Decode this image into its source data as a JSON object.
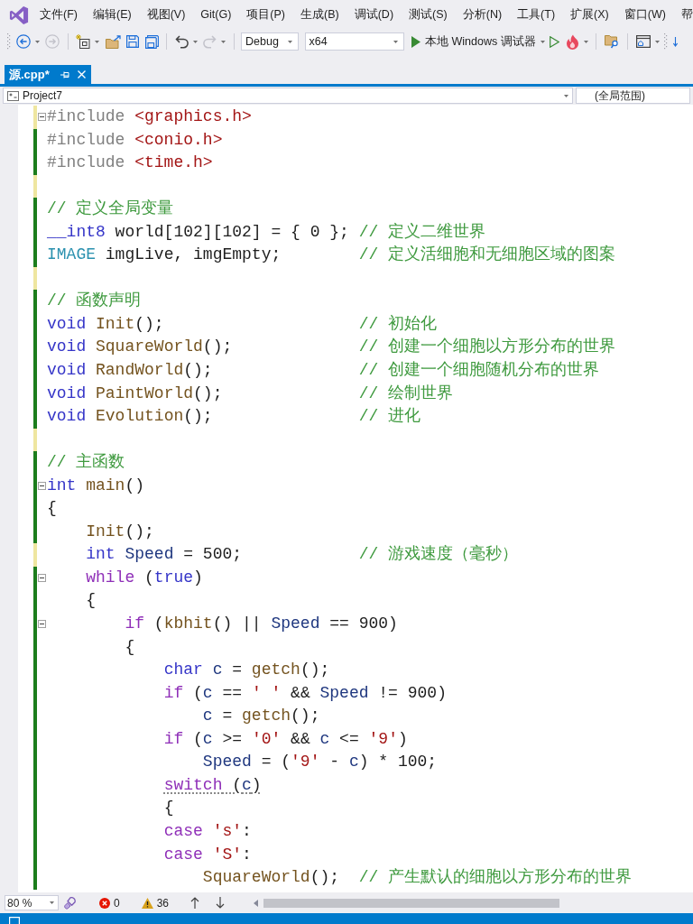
{
  "menu": {
    "items": [
      "文件(F)",
      "编辑(E)",
      "视图(V)",
      "Git(G)",
      "项目(P)",
      "生成(B)",
      "调试(D)",
      "测试(S)",
      "分析(N)",
      "工具(T)",
      "扩展(X)",
      "窗口(W)",
      "帮"
    ]
  },
  "toolbar": {
    "items": [
      {
        "kind": "grip"
      },
      {
        "kind": "back",
        "disabled": false,
        "dropdown": true
      },
      {
        "kind": "forward",
        "disabled": true,
        "dropdown": false
      },
      {
        "kind": "separator"
      },
      {
        "kind": "new_item",
        "disabled": false,
        "dropdown": true
      },
      {
        "kind": "open",
        "disabled": false,
        "dropdown": false
      },
      {
        "kind": "save",
        "disabled": false,
        "dropdown": false
      },
      {
        "kind": "save_all",
        "disabled": false,
        "dropdown": false
      },
      {
        "kind": "separator"
      },
      {
        "kind": "undo",
        "disabled": false,
        "dropdown": true
      },
      {
        "kind": "redo",
        "disabled": true,
        "dropdown": true
      },
      {
        "kind": "separator"
      },
      {
        "kind": "configuration_combo",
        "value": "Debug"
      },
      {
        "kind": "platform_combo",
        "value": "x64"
      },
      {
        "kind": "run",
        "label": "本地 Windows 调试器",
        "dropdown": true
      },
      {
        "kind": "run_no_debug",
        "disabled": false,
        "dropdown": false
      },
      {
        "kind": "hot_reload",
        "disabled": false,
        "dropdown": true
      },
      {
        "kind": "separator"
      },
      {
        "kind": "find_folder",
        "disabled": false,
        "dropdown": false
      },
      {
        "kind": "separator"
      },
      {
        "kind": "window",
        "disabled": false,
        "dropdown": true
      },
      {
        "kind": "grip"
      },
      {
        "kind": "step",
        "disabled": false,
        "dropdown": false
      }
    ]
  },
  "tabs": [
    {
      "label": "源.cpp*",
      "selected": true
    }
  ],
  "navigation": {
    "project": "Project7",
    "scope": "(全局范围)"
  },
  "code": {
    "lines": [
      {
        "segments": [
          {
            "text": "#include ",
            "kind": "preprocessor"
          },
          {
            "text": "<graphics.h>",
            "kind": "string"
          }
        ],
        "unsaved": true,
        "fold": true,
        "squiggle": false
      },
      {
        "segments": [
          {
            "text": "#include ",
            "kind": "preprocessor"
          },
          {
            "text": "<conio.h>",
            "kind": "string"
          }
        ],
        "unsaved": false,
        "fold": false,
        "squiggle": false
      },
      {
        "segments": [
          {
            "text": "#include ",
            "kind": "preprocessor"
          },
          {
            "text": "<time.h>",
            "kind": "string"
          }
        ],
        "unsaved": false,
        "fold": false,
        "squiggle": false
      },
      {
        "unsaved": true,
        "fold": false
      },
      {
        "segments": [
          {
            "text": "// 定义全局变量",
            "kind": "comment"
          }
        ],
        "unsaved": false,
        "fold": false,
        "squiggle": false
      },
      {
        "segments": [
          {
            "text": "__int8",
            "kind": "keyword"
          },
          {
            "text": " world[102][102] = { 0 }; ",
            "kind": "plain"
          },
          {
            "text": "// 定义二维世界",
            "kind": "comment"
          }
        ],
        "unsaved": false,
        "fold": false,
        "squiggle": false
      },
      {
        "segments": [
          {
            "text": "IMAGE",
            "kind": "type"
          },
          {
            "text": " imgLive, imgEmpty;        ",
            "kind": "plain"
          },
          {
            "text": "// 定义活细胞和无细胞区域的图案",
            "kind": "comment"
          }
        ],
        "unsaved": false,
        "fold": false,
        "squiggle": false
      },
      {
        "unsaved": true,
        "fold": false
      },
      {
        "segments": [
          {
            "text": "// 函数声明",
            "kind": "comment"
          }
        ],
        "unsaved": false,
        "fold": false,
        "squiggle": false
      },
      {
        "segments": [
          {
            "text": "void",
            "kind": "keyword"
          },
          {
            "text": " Init",
            "kind": "function"
          },
          {
            "text": "();                    ",
            "kind": "plain"
          },
          {
            "text": "// 初始化",
            "kind": "comment"
          }
        ],
        "unsaved": false,
        "fold": false,
        "squiggle": false
      },
      {
        "segments": [
          {
            "text": "void",
            "kind": "keyword"
          },
          {
            "text": " SquareWorld",
            "kind": "function"
          },
          {
            "text": "();             ",
            "kind": "plain"
          },
          {
            "text": "// 创建一个细胞以方形分布的世界",
            "kind": "comment"
          }
        ],
        "unsaved": false,
        "fold": false,
        "squiggle": false
      },
      {
        "segments": [
          {
            "text": "void",
            "kind": "keyword"
          },
          {
            "text": " RandWorld",
            "kind": "function"
          },
          {
            "text": "();               ",
            "kind": "plain"
          },
          {
            "text": "// 创建一个细胞随机分布的世界",
            "kind": "comment"
          }
        ],
        "unsaved": false,
        "fold": false,
        "squiggle": false
      },
      {
        "segments": [
          {
            "text": "void",
            "kind": "keyword"
          },
          {
            "text": " PaintWorld",
            "kind": "function"
          },
          {
            "text": "();              ",
            "kind": "plain"
          },
          {
            "text": "// 绘制世界",
            "kind": "comment"
          }
        ],
        "unsaved": false,
        "fold": false,
        "squiggle": false
      },
      {
        "segments": [
          {
            "text": "void",
            "kind": "keyword"
          },
          {
            "text": " Evolution",
            "kind": "function"
          },
          {
            "text": "();               ",
            "kind": "plain"
          },
          {
            "text": "// 进化",
            "kind": "comment"
          }
        ],
        "unsaved": false,
        "fold": false,
        "squiggle": false
      },
      {
        "unsaved": true,
        "fold": false
      },
      {
        "segments": [
          {
            "text": "// 主函数",
            "kind": "comment"
          }
        ],
        "unsaved": false,
        "fold": false,
        "squiggle": false
      },
      {
        "segments": [
          {
            "text": "int",
            "kind": "keyword"
          },
          {
            "text": " main",
            "kind": "function"
          },
          {
            "text": "()",
            "kind": "plain"
          }
        ],
        "unsaved": false,
        "fold": true,
        "squiggle": false
      },
      {
        "segments": [
          {
            "text": "{",
            "kind": "plain"
          }
        ],
        "unsaved": false,
        "fold": false,
        "squiggle": false
      },
      {
        "segments": [
          {
            "text": "    Init",
            "kind": "function"
          },
          {
            "text": "();",
            "kind": "plain"
          }
        ],
        "unsaved": false,
        "fold": false,
        "squiggle": false
      },
      {
        "segments": [
          {
            "text": "    int",
            "kind": "keyword"
          },
          {
            "text": " Speed",
            "kind": "local"
          },
          {
            "text": " = 500;            ",
            "kind": "plain"
          },
          {
            "text": "// 游戏速度（毫秒）",
            "kind": "comment"
          }
        ],
        "unsaved": true,
        "fold": false,
        "squiggle": false
      },
      {
        "segments": [
          {
            "text": "    while",
            "kind": "control"
          },
          {
            "text": " (",
            "kind": "plain"
          },
          {
            "text": "true",
            "kind": "keyword"
          },
          {
            "text": ")",
            "kind": "plain"
          }
        ],
        "unsaved": false,
        "fold": true,
        "squiggle": false
      },
      {
        "segments": [
          {
            "text": "    {",
            "kind": "plain"
          }
        ],
        "unsaved": false,
        "fold": false,
        "squiggle": false
      },
      {
        "segments": [
          {
            "text": "        if",
            "kind": "control"
          },
          {
            "text": " (",
            "kind": "plain"
          },
          {
            "text": "kbhit",
            "kind": "function"
          },
          {
            "text": "() || ",
            "kind": "plain"
          },
          {
            "text": "Speed",
            "kind": "local"
          },
          {
            "text": " == 900)",
            "kind": "plain"
          }
        ],
        "unsaved": false,
        "fold": true,
        "squiggle": false
      },
      {
        "segments": [
          {
            "text": "        {",
            "kind": "plain"
          }
        ],
        "unsaved": false,
        "fold": false,
        "squiggle": false
      },
      {
        "segments": [
          {
            "text": "            char",
            "kind": "keyword"
          },
          {
            "text": " c",
            "kind": "local"
          },
          {
            "text": " = ",
            "kind": "plain"
          },
          {
            "text": "getch",
            "kind": "function"
          },
          {
            "text": "();",
            "kind": "plain"
          }
        ],
        "unsaved": false,
        "fold": false,
        "squiggle": false
      },
      {
        "segments": [
          {
            "text": "            if",
            "kind": "control"
          },
          {
            "text": " (",
            "kind": "plain"
          },
          {
            "text": "c",
            "kind": "local"
          },
          {
            "text": " == ",
            "kind": "plain"
          },
          {
            "text": "' '",
            "kind": "string"
          },
          {
            "text": " && ",
            "kind": "plain"
          },
          {
            "text": "Speed",
            "kind": "local"
          },
          {
            "text": " != 900)",
            "kind": "plain"
          }
        ],
        "unsaved": false,
        "fold": false,
        "squiggle": false
      },
      {
        "segments": [
          {
            "text": "                c",
            "kind": "local"
          },
          {
            "text": " = ",
            "kind": "plain"
          },
          {
            "text": "getch",
            "kind": "function"
          },
          {
            "text": "();",
            "kind": "plain"
          }
        ],
        "unsaved": false,
        "fold": false,
        "squiggle": false
      },
      {
        "segments": [
          {
            "text": "            if",
            "kind": "control"
          },
          {
            "text": " (",
            "kind": "plain"
          },
          {
            "text": "c",
            "kind": "local"
          },
          {
            "text": " >= ",
            "kind": "plain"
          },
          {
            "text": "'0'",
            "kind": "string"
          },
          {
            "text": " && ",
            "kind": "plain"
          },
          {
            "text": "c",
            "kind": "local"
          },
          {
            "text": " <= ",
            "kind": "plain"
          },
          {
            "text": "'9'",
            "kind": "string"
          },
          {
            "text": ")",
            "kind": "plain"
          }
        ],
        "unsaved": false,
        "fold": false,
        "squiggle": false
      },
      {
        "segments": [
          {
            "text": "                Speed",
            "kind": "local"
          },
          {
            "text": " = (",
            "kind": "plain"
          },
          {
            "text": "'9'",
            "kind": "string"
          },
          {
            "text": " - ",
            "kind": "plain"
          },
          {
            "text": "c",
            "kind": "local"
          },
          {
            "text": ") * 100;",
            "kind": "plain"
          }
        ],
        "unsaved": false,
        "fold": false,
        "squiggle": false
      },
      {
        "segments": [
          {
            "text": "            switch",
            "kind": "control"
          },
          {
            "text": " (",
            "kind": "plain"
          },
          {
            "text": "c",
            "kind": "local"
          },
          {
            "text": ")",
            "kind": "plain"
          }
        ],
        "unsaved": false,
        "fold": false,
        "squiggle": true
      },
      {
        "segments": [
          {
            "text": "            {",
            "kind": "plain"
          }
        ],
        "unsaved": false,
        "fold": false,
        "squiggle": false
      },
      {
        "segments": [
          {
            "text": "            case",
            "kind": "control"
          },
          {
            "text": " 's'",
            "kind": "string"
          },
          {
            "text": ":",
            "kind": "plain"
          }
        ],
        "unsaved": false,
        "fold": false,
        "squiggle": false
      },
      {
        "segments": [
          {
            "text": "            case",
            "kind": "control"
          },
          {
            "text": " 'S'",
            "kind": "string"
          },
          {
            "text": ":",
            "kind": "plain"
          }
        ],
        "unsaved": false,
        "fold": false,
        "squiggle": false
      },
      {
        "segments": [
          {
            "text": "                SquareWorld",
            "kind": "function"
          },
          {
            "text": "();  ",
            "kind": "plain"
          },
          {
            "text": "// 产生默认的细胞以方形分布的世界",
            "kind": "comment"
          }
        ],
        "unsaved": false,
        "fold": false,
        "squiggle": false
      }
    ]
  },
  "editor_footer": {
    "zoom": "80 %",
    "errors": "0",
    "warnings": "36"
  }
}
